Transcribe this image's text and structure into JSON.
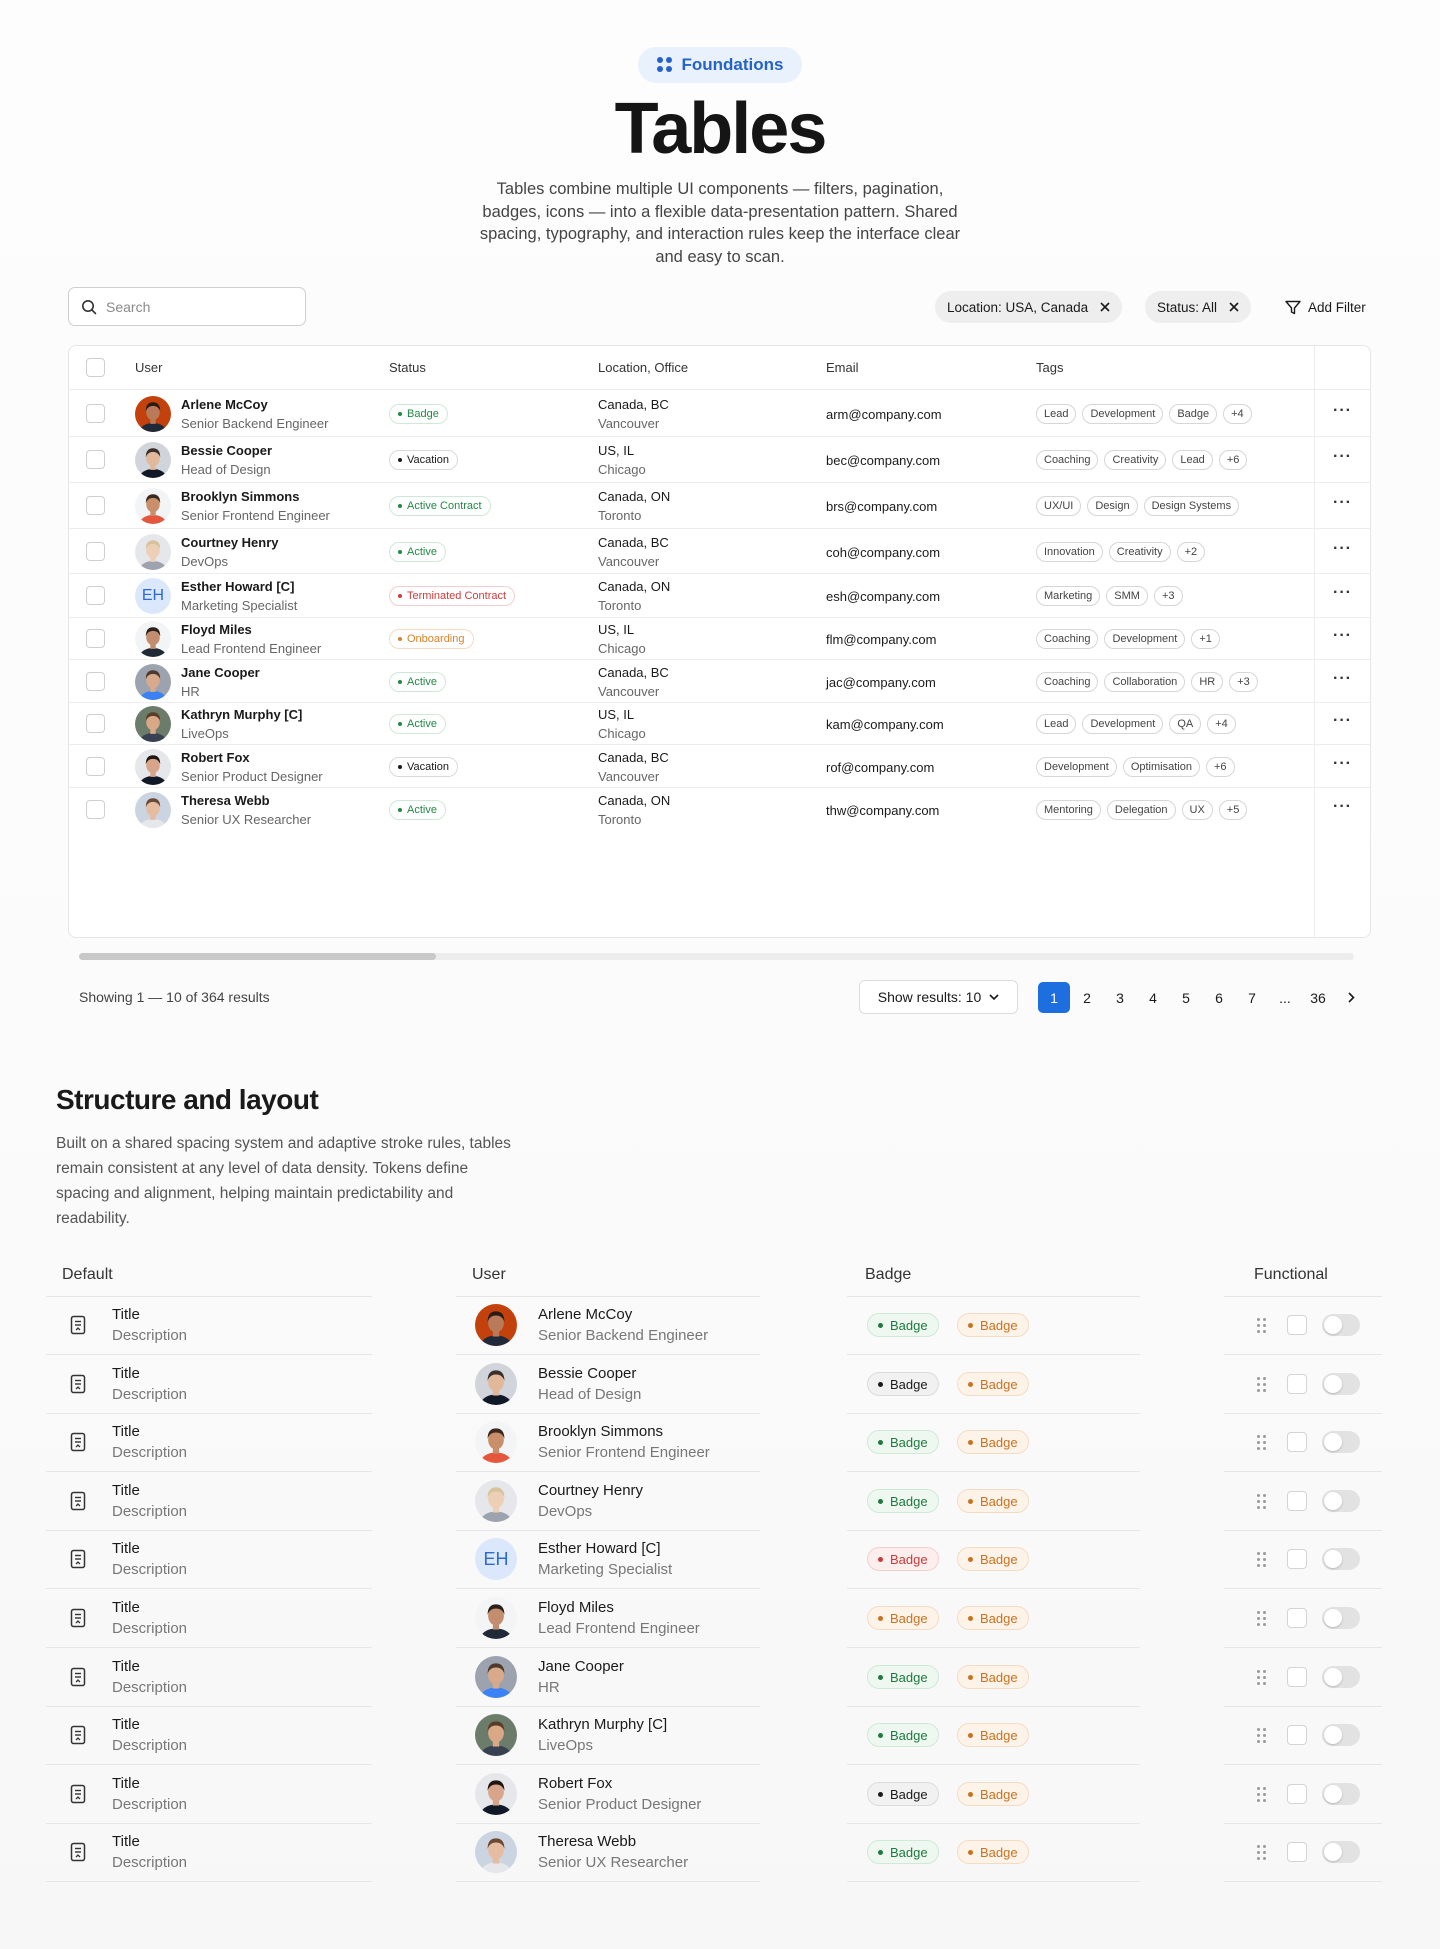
{
  "hero": {
    "pill_label": "Foundations",
    "title": "Tables",
    "description": "Tables combine multiple UI components — filters, pagination, badges, icons — into a flexible data-presentation pattern. Shared spacing, typography, and interaction rules keep the interface clear and easy to scan."
  },
  "toolbar": {
    "search_placeholder": "Search",
    "filters": [
      {
        "label": "Location: USA, Canada"
      },
      {
        "label": "Status: All"
      }
    ],
    "add_filter_label": "Add Filter"
  },
  "table": {
    "columns": [
      "User",
      "Status",
      "Location, Office",
      "Email",
      "Tags"
    ],
    "rows": [
      {
        "name": "Arlene McCoy",
        "role": "Senior Backend Engineer",
        "status": "Badge",
        "status_color": "green",
        "loc1": "Canada, BC",
        "loc2": "Vancouver",
        "email": "arm@company.com",
        "tags": [
          "Lead",
          "Development",
          "Badge",
          "+4"
        ],
        "avatar": "a1"
      },
      {
        "name": "Bessie Cooper",
        "role": "Head of Design",
        "status": "Vacation",
        "status_color": "gray",
        "loc1": "US, IL",
        "loc2": "Chicago",
        "email": "bec@company.com",
        "tags": [
          "Coaching",
          "Creativity",
          "Lead",
          "+6"
        ],
        "avatar": "a2"
      },
      {
        "name": "Brooklyn Simmons",
        "role": "Senior Frontend Engineer",
        "status": "Active Contract",
        "status_color": "green",
        "loc1": "Canada, ON",
        "loc2": "Toronto",
        "email": "brs@company.com",
        "tags": [
          "UX/UI",
          "Design",
          "Design Systems"
        ],
        "avatar": "a3"
      },
      {
        "name": "Courtney Henry",
        "role": "DevOps",
        "status": "Active",
        "status_color": "green",
        "loc1": "Canada, BC",
        "loc2": "Vancouver",
        "email": "coh@company.com",
        "tags": [
          "Innovation",
          "Creativity",
          "+2"
        ],
        "avatar": "a4"
      },
      {
        "name": "Esther Howard [C]",
        "role": "Marketing Specialist",
        "status": "Terminated Contract",
        "status_color": "red",
        "loc1": "Canada, ON",
        "loc2": "Toronto",
        "email": "esh@company.com",
        "tags": [
          "Marketing",
          "SMM",
          "+3"
        ],
        "avatar": "initials",
        "initials": "EH"
      },
      {
        "name": "Floyd Miles",
        "role": "Lead Frontend Engineer",
        "status": "Onboarding",
        "status_color": "orange",
        "loc1": "US, IL",
        "loc2": "Chicago",
        "email": "flm@company.com",
        "tags": [
          "Coaching",
          "Development",
          "+1"
        ],
        "avatar": "a6"
      },
      {
        "name": "Jane Cooper",
        "role": "HR",
        "status": "Active",
        "status_color": "green",
        "loc1": "Canada, BC",
        "loc2": "Vancouver",
        "email": "jac@company.com",
        "tags": [
          "Coaching",
          "Collaboration",
          "HR",
          "+3"
        ],
        "avatar": "a7"
      },
      {
        "name": "Kathryn Murphy [C]",
        "role": "LiveOps",
        "status": "Active",
        "status_color": "green",
        "loc1": "US, IL",
        "loc2": "Chicago",
        "email": "kam@company.com",
        "tags": [
          "Lead",
          "Development",
          "QA",
          "+4"
        ],
        "avatar": "a8"
      },
      {
        "name": "Robert Fox",
        "role": "Senior Product Designer",
        "status": "Vacation",
        "status_color": "gray",
        "loc1": "Canada, BC",
        "loc2": "Vancouver",
        "email": "rof@company.com",
        "tags": [
          "Development",
          "Optimisation",
          "+6"
        ],
        "avatar": "a9"
      },
      {
        "name": "Theresa Webb",
        "role": "Senior UX Researcher",
        "status": "Active",
        "status_color": "green",
        "loc1": "Canada, ON",
        "loc2": "Toronto",
        "email": "thw@company.com",
        "tags": [
          "Mentoring",
          "Delegation",
          "UX",
          "+5"
        ],
        "avatar": "a10"
      }
    ],
    "scroll_fraction": 0.28
  },
  "pagination": {
    "showing": "Showing 1 — 10 of 364 results",
    "page_size_label": "Show results: 10",
    "pages": [
      "1",
      "2",
      "3",
      "4",
      "5",
      "6",
      "7",
      "...",
      "36"
    ],
    "active_page": "1"
  },
  "structure": {
    "title": "Structure and layout",
    "description": "Built on a shared spacing system and adaptive stroke rules, tables remain consistent at any level of data density. Tokens define spacing and alignment, helping maintain predictability and readability.",
    "columns": {
      "default": "Default",
      "user": "User",
      "badge": "Badge",
      "functional": "Functional"
    },
    "default_rows": [
      {
        "title": "Title",
        "description": "Description"
      },
      {
        "title": "Title",
        "description": "Description"
      },
      {
        "title": "Title",
        "description": "Description"
      },
      {
        "title": "Title",
        "description": "Description"
      },
      {
        "title": "Title",
        "description": "Description"
      },
      {
        "title": "Title",
        "description": "Description"
      },
      {
        "title": "Title",
        "description": "Description"
      },
      {
        "title": "Title",
        "description": "Description"
      },
      {
        "title": "Title",
        "description": "Description"
      },
      {
        "title": "Title",
        "description": "Description"
      }
    ],
    "badge_rows": [
      {
        "first": "Badge",
        "first_color": "green",
        "second": "Badge"
      },
      {
        "first": "Badge",
        "first_color": "gray",
        "second": "Badge"
      },
      {
        "first": "Badge",
        "first_color": "green",
        "second": "Badge"
      },
      {
        "first": "Badge",
        "first_color": "green",
        "second": "Badge"
      },
      {
        "first": "Badge",
        "first_color": "red",
        "second": "Badge"
      },
      {
        "first": "Badge",
        "first_color": "orange",
        "second": "Badge"
      },
      {
        "first": "Badge",
        "first_color": "green",
        "second": "Badge"
      },
      {
        "first": "Badge",
        "first_color": "green",
        "second": "Badge"
      },
      {
        "first": "Badge",
        "first_color": "gray",
        "second": "Badge"
      },
      {
        "first": "Badge",
        "first_color": "green",
        "second": "Badge"
      }
    ]
  },
  "colors": {
    "accent": "#1d6fe0",
    "pill_bg": "#e9f1fd",
    "green": "#1f8a44",
    "red": "#d13b3b",
    "orange": "#d9822b"
  },
  "icons": [
    "foundations-icon",
    "search-icon",
    "close-icon",
    "filter-icon",
    "chevron-down-icon",
    "chevron-right-icon",
    "more-icon",
    "document-icon",
    "drag-handle-icon"
  ]
}
